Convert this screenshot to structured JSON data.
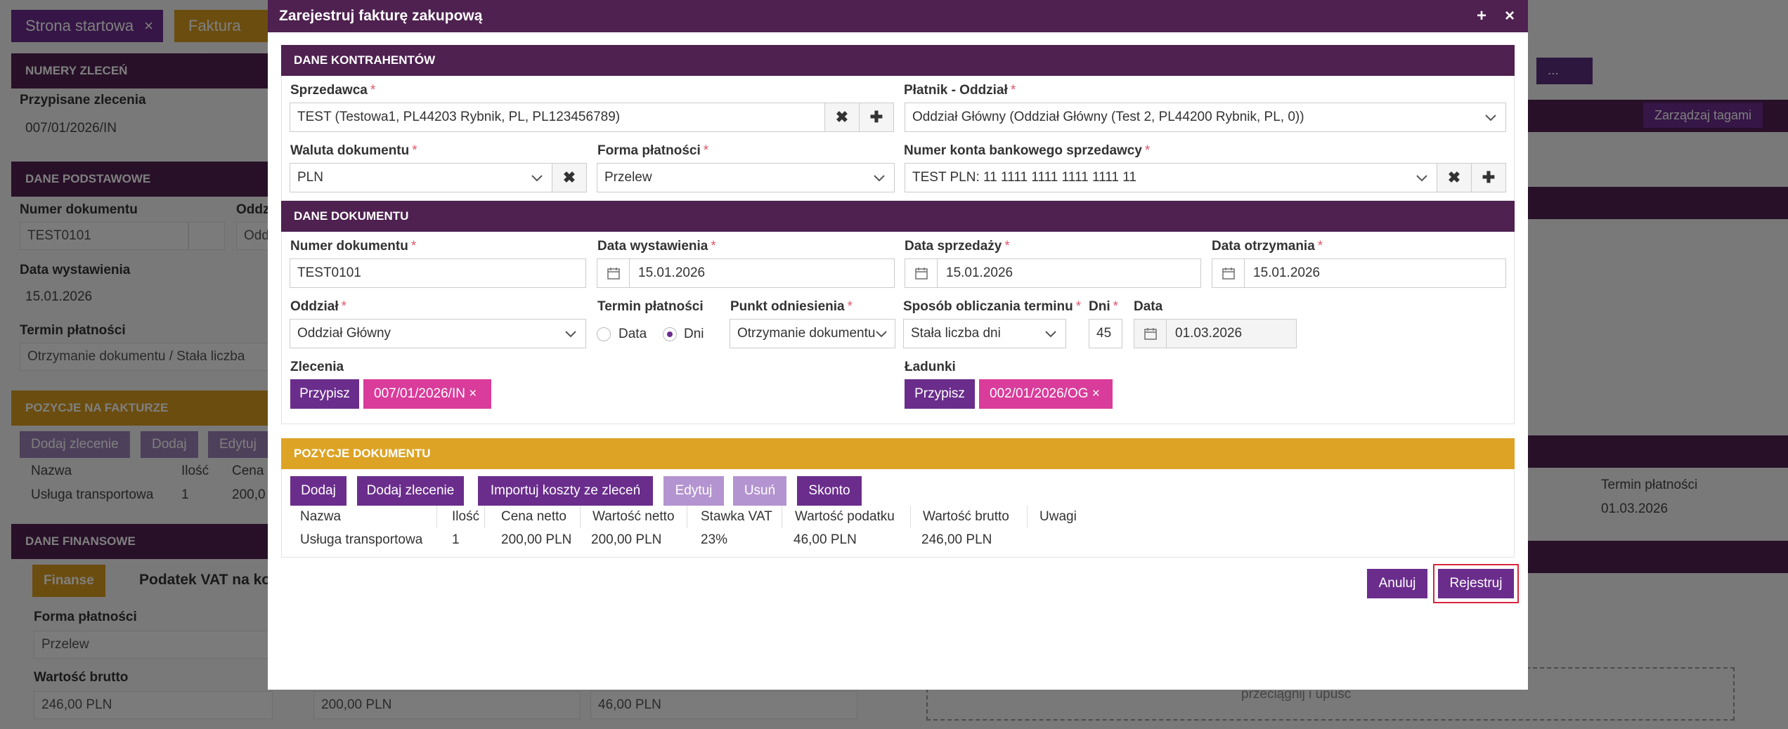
{
  "background": {
    "tabs": [
      {
        "label": "Strona startowa",
        "close": "×"
      },
      {
        "label": "Faktura zaku"
      }
    ],
    "sections": {
      "numery": "NUMERY ZLECEŃ",
      "podstawowe": "DANE PODSTAWOWE",
      "pozycje": "POZYCJE NA FAKTURZE",
      "finansowe": "DANE FINANSOWE"
    },
    "przypisane_label": "Przypisane zlecenia",
    "przypisane_value": "007/01/2026/IN",
    "numer_label": "Numer dokumentu",
    "numer_value": "TEST0101",
    "odd_label": "Oddz",
    "odd_value": "Odd",
    "data_wyst_label": "Data wystawienia",
    "data_wyst_value": "15.01.2026",
    "termin_label": "Termin płatności",
    "termin_value": "Otrzymanie dokumentu / Stała liczba",
    "buttons": [
      "Dodaj zlecenie",
      "Dodaj",
      "Edytuj"
    ],
    "col_nazwa": "Nazwa",
    "col_ilosc": "Ilość",
    "col_cena": "Cena",
    "row_nazwa": "Usługa transportowa",
    "row_ilosc": "1",
    "row_cena": "200,0",
    "fin_tab": "Finanse",
    "vat_tab": "Podatek VAT na ko",
    "forma_label": "Forma płatności",
    "forma_value": "Przelew",
    "brutto_label": "Wartość brutto",
    "brutto_value": "246,00 PLN",
    "netto_value": "200,00 PLN",
    "podatek_value": "46,00 PLN",
    "more_btn": "...",
    "tags_btn": "Zarządzaj tagami",
    "right_termin_label": "Termin płatności",
    "right_termin_value": "01.03.2026",
    "drop_text": "przeciągnij i upuść"
  },
  "modal": {
    "title": "Zarejestruj fakturę zakupową",
    "max_icon": "+",
    "close_icon": "×",
    "required_mark": "*",
    "sec_kontrahentow": "DANE KONTRAHENTÓW",
    "sprzedawca_label": "Sprzedawca",
    "sprzedawca_value": "TEST (Testowa1, PL44203 Rybnik, PL, PL123456789)",
    "platnik_label": "Płatnik - Oddział",
    "platnik_value": "Oddział Główny  (Oddział Główny  (Test 2, PL44200 Rybnik, PL, 0))",
    "waluta_label": "Waluta dokumentu",
    "waluta_value": "PLN",
    "forma_label": "Forma płatności",
    "forma_value": "Przelew",
    "konto_label": "Numer konta bankowego sprzedawcy",
    "konto_value": "TEST PLN: 11 1111 1111 1111 1111 11",
    "sec_dokumentu": "DANE DOKUMENTU",
    "numer_label": "Numer dokumentu",
    "numer_value": "TEST0101",
    "data_wyst_label": "Data wystawienia",
    "data_wyst_value": "15.01.2026",
    "data_sprz_label": "Data sprzedaży",
    "data_sprz_value": "15.01.2026",
    "data_otrz_label": "Data otrzymania",
    "data_otrz_value": "15.01.2026",
    "oddzial_label": "Oddział",
    "oddzial_value": "Oddział Główny",
    "termin_label": "Termin płatności",
    "radio_data": "Data",
    "radio_dni": "Dni",
    "punkt_label": "Punkt odniesienia",
    "punkt_value": "Otrzymanie dokumentu",
    "sposob_label": "Sposób obliczania terminu",
    "sposob_value": "Stała liczba dni",
    "dni_label": "Dni",
    "dni_value": "45",
    "data_label": "Data",
    "data_value": "01.03.2026",
    "zlecenia_label": "Zlecenia",
    "przypisz_label": "Przypisz",
    "zlecenie_tag": "007/01/2026/IN ×",
    "ladunki_label": "Ładunki",
    "ladunek_tag": "002/01/2026/OG ×",
    "sec_pozycje": "POZYCJE DOKUMENTU",
    "btn_dodaj": "Dodaj",
    "btn_dodaj_zlecenie": "Dodaj zlecenie",
    "btn_importuj": "Importuj koszty ze zleceń",
    "btn_edytuj": "Edytuj",
    "btn_usun": "Usuń",
    "btn_skonto": "Skonto",
    "columns": [
      "Nazwa",
      "Ilość",
      "Cena netto",
      "Wartość netto",
      "Stawka VAT",
      "Wartość podatku",
      "Wartość brutto",
      "Uwagi"
    ],
    "row": [
      "Usługa transportowa",
      "1",
      "200,00 PLN",
      "200,00 PLN",
      "23%",
      "46,00 PLN",
      "246,00 PLN",
      ""
    ],
    "btn_anuluj": "Anuluj",
    "btn_rejestruj": "Rejestruj"
  },
  "colors": {
    "primary": "#4e2150",
    "button": "#6a2d8c",
    "gold": "#dda325",
    "tag": "#d93c9a",
    "highlight": "#d9263b"
  }
}
